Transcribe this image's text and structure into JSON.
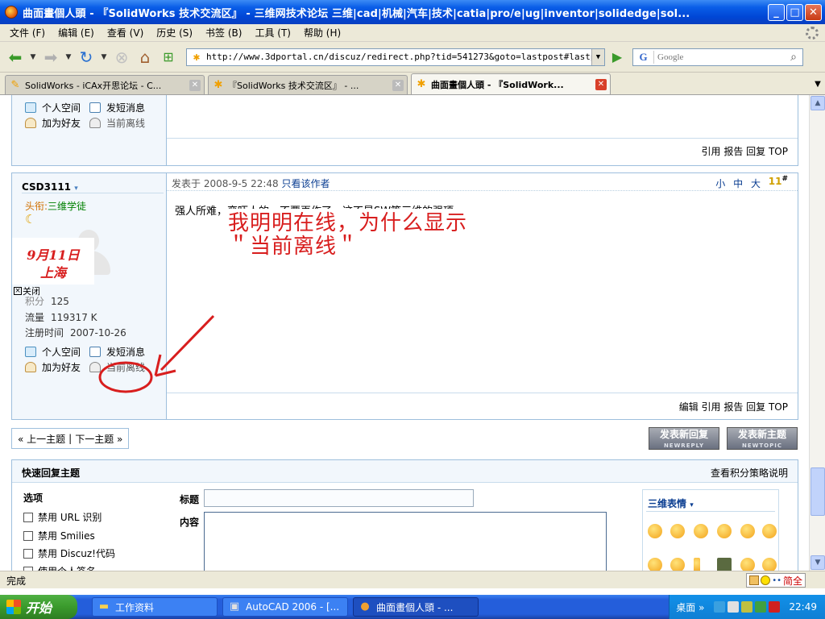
{
  "window": {
    "title": "曲面畫個人頭 - 『SolidWorks 技术交流区』 - 三维网技术论坛 三维|cad|机械|汽车|技术|catia|pro/e|ug|inventor|solidedge|sol...",
    "minimize": "_",
    "maximize": "□",
    "close": "✕"
  },
  "menu": [
    "文件 (F)",
    "编辑 (E)",
    "查看 (V)",
    "历史 (S)",
    "书签 (B)",
    "工具 (T)",
    "帮助 (H)"
  ],
  "nav": {
    "url": "http://www.3dportal.cn/discuz/redirect.php?tid=541273&goto=lastpost#lastpost",
    "search_engine": "G",
    "search_placeholder": "Google"
  },
  "tabs": [
    {
      "label": "SolidWorks - iCAx开思论坛 - C...",
      "active": false
    },
    {
      "label": "『SolidWorks 技术交流区』 - ...",
      "active": false
    },
    {
      "label": "曲面畫個人頭 - 『SolidWork...",
      "active": true
    }
  ],
  "post1": {
    "links": {
      "space": "个人空间",
      "pm": "发短消息",
      "add_friend": "加为好友",
      "offline": "当前离线"
    },
    "actions": "引用 报告 回复 TOP"
  },
  "post2": {
    "username": "CSD3111",
    "rank_label": "头衔:",
    "rank_title": "三维学徒",
    "ad": {
      "line1": "9月11日",
      "line2": "上海"
    },
    "close_label": "关闭",
    "stats": [
      {
        "label": "积分",
        "value": "125"
      },
      {
        "label": "流量",
        "value": "119317 K"
      },
      {
        "label": "注册时间",
        "value": "2007-10-26"
      }
    ],
    "links": {
      "space": "个人空间",
      "pm": "发短消息",
      "add_friend": "加为好友",
      "offline": "当前离线"
    },
    "posted_at": "发表于 2008-9-5 22:48",
    "only_author": "只看该作者",
    "font_sizes": [
      "小",
      "中",
      "大"
    ],
    "floor": "11",
    "floor_mark": "#",
    "message": "强人所难，蛮吓人的。不要再作了，这不是SW等三维的强项",
    "annotation": "我明明在线，为什么显示＂当前离线＂",
    "actions": "编辑 引用 报告 回复 TOP"
  },
  "pager": {
    "prev": "« 上一主题",
    "sep": "|",
    "next": "下一主题 »"
  },
  "buttons": {
    "new_reply": "发表新回复",
    "new_reply_sub": "NEWREPLY",
    "new_topic": "发表新主题",
    "new_topic_sub": "NEWTOPIC"
  },
  "quick_reply": {
    "title": "快速回复主题",
    "credit_link": "查看积分策略说明",
    "options_label": "选项",
    "options": [
      "禁用 URL 识别",
      "禁用 Smilies",
      "禁用 Discuz!代码",
      "使用个人签名"
    ],
    "subject_label": "标题",
    "content_label": "内容",
    "emoticons_title": "三维表情"
  },
  "status": {
    "text": "完成",
    "ext_text": "简全"
  },
  "taskbar": {
    "start": "开始",
    "items": [
      {
        "label": "工作资料",
        "active": false
      },
      {
        "label": "AutoCAD 2006 - [...",
        "active": false
      },
      {
        "label": "曲面畫個人頭 - ...",
        "active": true
      }
    ],
    "desktop": "桌面",
    "time": "22:49"
  },
  "colors": {
    "annotation_red": "#d81e1e",
    "link_blue": "#0a3d91",
    "border_blue": "#9ebfdd"
  }
}
